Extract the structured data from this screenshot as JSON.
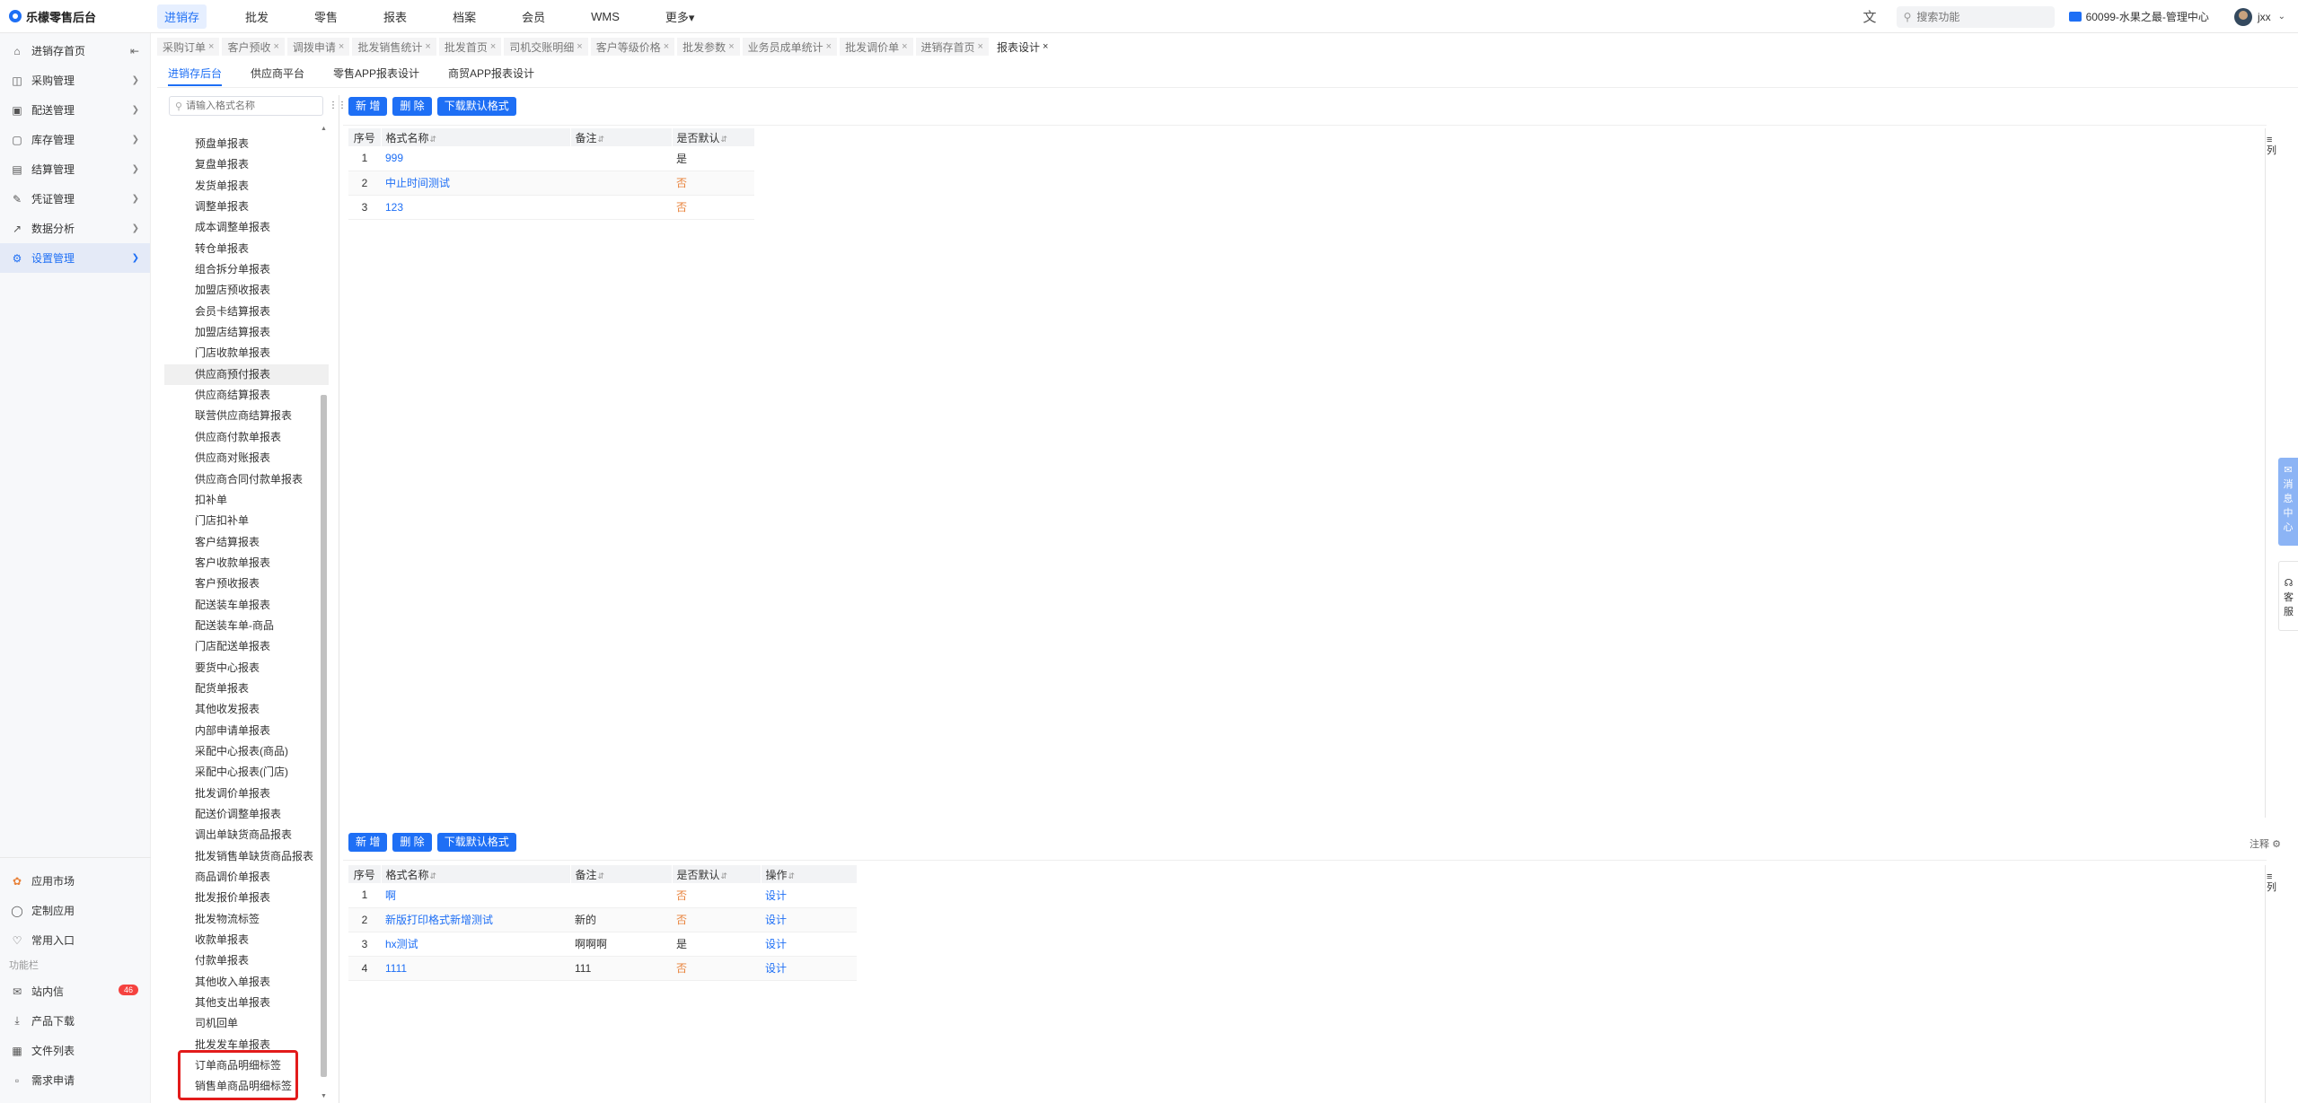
{
  "brand": {
    "name": "乐檬零售后台"
  },
  "topmenu": [
    "进销存",
    "批发",
    "零售",
    "报表",
    "档案",
    "会员",
    "WMS",
    "更多▾"
  ],
  "topright": {
    "search_placeholder": "搜索功能",
    "store": "60099-水果之最-管理中心",
    "user": "jxx"
  },
  "sidebar": {
    "items": [
      {
        "label": "进销存首页",
        "icon": "home-icon"
      },
      {
        "label": "采购管理",
        "icon": "cart-icon"
      },
      {
        "label": "配送管理",
        "icon": "truck-icon"
      },
      {
        "label": "库存管理",
        "icon": "box-icon"
      },
      {
        "label": "结算管理",
        "icon": "wallet-icon"
      },
      {
        "label": "凭证管理",
        "icon": "voucher-icon"
      },
      {
        "label": "数据分析",
        "icon": "chart-icon"
      },
      {
        "label": "设置管理",
        "icon": "gear-icon"
      }
    ],
    "bottom": [
      {
        "label": "应用市场",
        "icon": "apps-icon"
      },
      {
        "label": "定制应用",
        "icon": "custom-icon"
      },
      {
        "label": "常用入口",
        "icon": "heart-icon"
      }
    ],
    "section_label": "功能栏",
    "bottom2": [
      {
        "label": "站内信",
        "icon": "mail-icon"
      },
      {
        "label": "产品下载",
        "icon": "download-icon"
      },
      {
        "label": "文件列表",
        "icon": "file-icon"
      },
      {
        "label": "需求申请",
        "icon": "request-icon"
      }
    ],
    "badge": "46"
  },
  "tabs": [
    "采购订单",
    "客户预收",
    "调拨申请",
    "批发销售统计",
    "批发首页",
    "司机交账明细",
    "客户等级价格",
    "批发参数",
    "业务员成单统计",
    "批发调价单",
    "进销存首页",
    "报表设计"
  ],
  "subtabs": [
    "进销存后台",
    "供应商平台",
    "零售APP报表设计",
    "商贸APP报表设计"
  ],
  "tree": {
    "search_placeholder": "请输入格式名称",
    "items": [
      "预盘单报表",
      "复盘单报表",
      "发货单报表",
      "调整单报表",
      "成本调整单报表",
      "转仓单报表",
      "组合拆分单报表",
      "加盟店预收报表",
      "会员卡结算报表",
      "加盟店结算报表",
      "门店收款单报表",
      "供应商预付报表",
      "供应商结算报表",
      "联营供应商结算报表",
      "供应商付款单报表",
      "供应商对账报表",
      "供应商合同付款单报表",
      "扣补单",
      "门店扣补单",
      "客户结算报表",
      "客户收款单报表",
      "客户预收报表",
      "配送装车单报表",
      "配送装车单-商品",
      "门店配送单报表",
      "要货中心报表",
      "配货单报表",
      "其他收发报表",
      "内部申请单报表",
      "采配中心报表(商品)",
      "采配中心报表(门店)",
      "批发调价单报表",
      "配送价调整单报表",
      "调出单缺货商品报表",
      "批发销售单缺货商品报表",
      "商品调价单报表",
      "批发报价单报表",
      "批发物流标签",
      "收款单报表",
      "付款单报表",
      "其他收入单报表",
      "其他支出单报表",
      "司机回单",
      "批发发车单报表",
      "订单商品明细标签",
      "销售单商品明细标签"
    ]
  },
  "buttons": {
    "add": "新 增",
    "delete": "删 除",
    "download": "下载默认格式"
  },
  "table1": {
    "headers": [
      "序号",
      "格式名称",
      "备注",
      "是否默认"
    ],
    "rows": [
      {
        "idx": "1",
        "name": "999",
        "note": "",
        "default": "是"
      },
      {
        "idx": "2",
        "name": "中止时间测试",
        "note": "",
        "default": "否"
      },
      {
        "idx": "3",
        "name": "123",
        "note": "",
        "default": "否"
      }
    ]
  },
  "table2": {
    "headers": [
      "序号",
      "格式名称",
      "备注",
      "是否默认",
      "操作"
    ],
    "rows": [
      {
        "idx": "1",
        "name": "啊",
        "note": "",
        "default": "否",
        "op": "设计"
      },
      {
        "idx": "2",
        "name": "新版打印格式新增测试",
        "note": "新的",
        "default": "否",
        "op": "设计"
      },
      {
        "idx": "3",
        "name": "hx测试",
        "note": "啊啊啊",
        "default": "是",
        "op": "设计"
      },
      {
        "idx": "4",
        "name": "1111",
        "note": "111",
        "default": "否",
        "op": "设计"
      }
    ]
  },
  "columns_label": "列",
  "note_label": "注释",
  "float_widgets": {
    "msg_center": "消息中心",
    "service": "客服"
  }
}
